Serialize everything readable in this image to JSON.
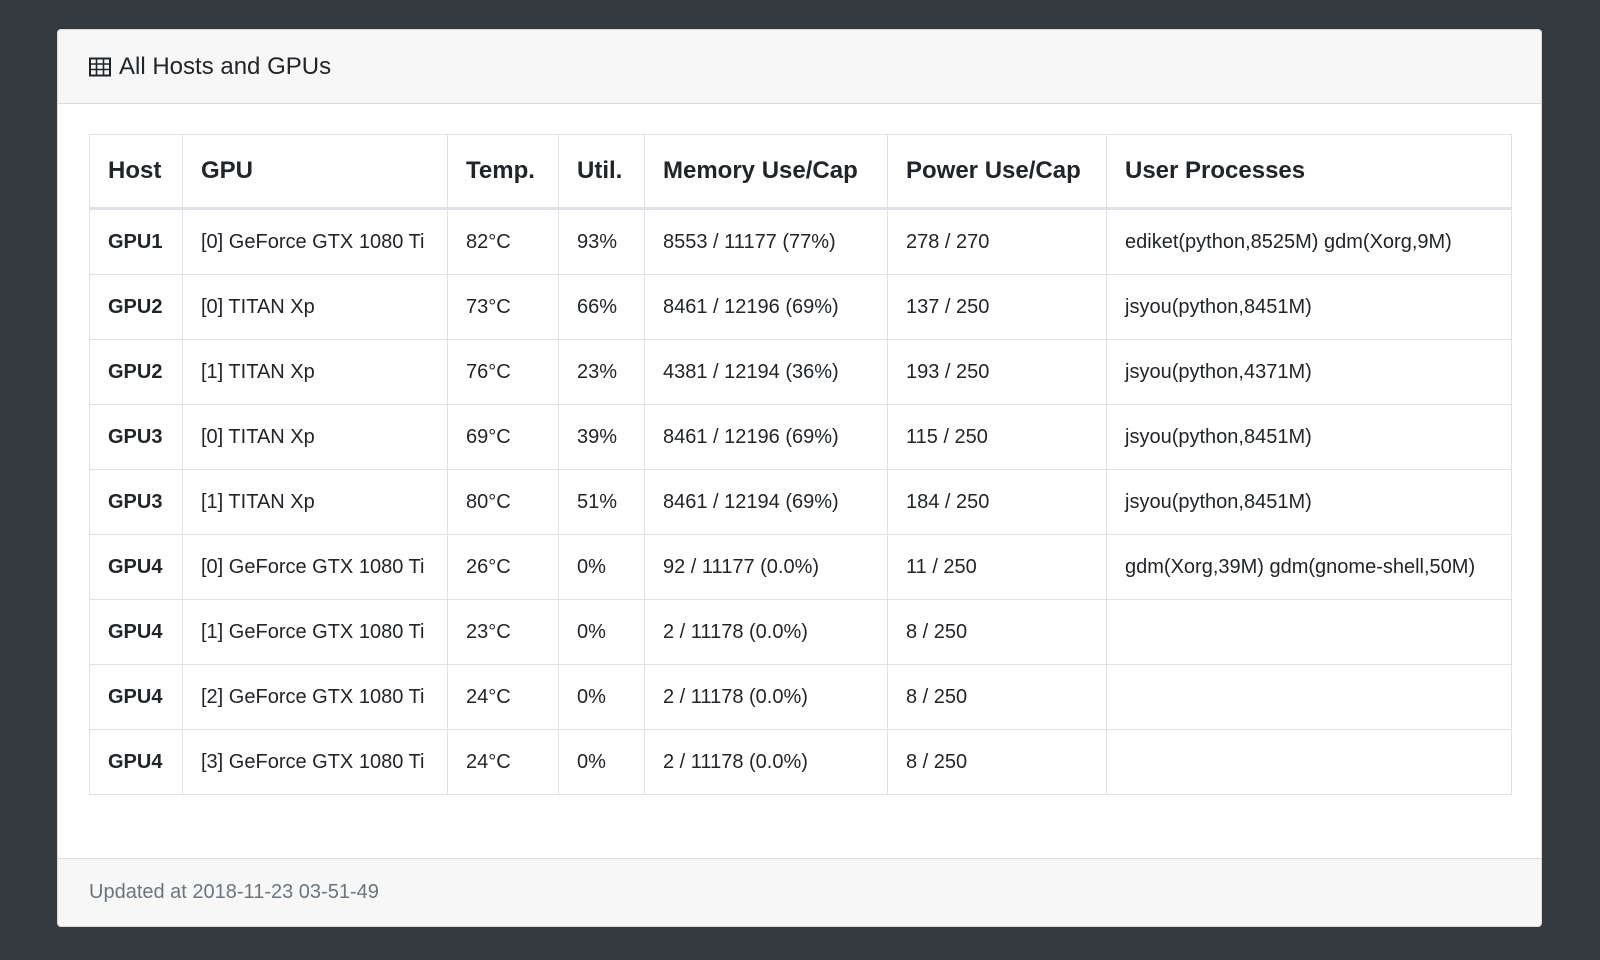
{
  "card": {
    "title": "All Hosts and GPUs",
    "title_icon": "table-icon"
  },
  "table": {
    "headers": [
      "Host",
      "GPU",
      "Temp.",
      "Util.",
      "Memory Use/Cap",
      "Power Use/Cap",
      "User Processes"
    ],
    "rows": [
      {
        "host": "GPU1",
        "gpu": "[0] GeForce GTX 1080 Ti",
        "temp": "82°C",
        "util": "93%",
        "memory": "8553 / 11177 (77%)",
        "power": "278 / 270",
        "processes": "ediket(python,8525M) gdm(Xorg,9M)"
      },
      {
        "host": "GPU2",
        "gpu": "[0] TITAN Xp",
        "temp": "73°C",
        "util": "66%",
        "memory": "8461 / 12196 (69%)",
        "power": "137 / 250",
        "processes": "jsyou(python,8451M)"
      },
      {
        "host": "GPU2",
        "gpu": "[1] TITAN Xp",
        "temp": "76°C",
        "util": "23%",
        "memory": "4381 / 12194 (36%)",
        "power": "193 / 250",
        "processes": "jsyou(python,4371M)"
      },
      {
        "host": "GPU3",
        "gpu": "[0] TITAN Xp",
        "temp": "69°C",
        "util": "39%",
        "memory": "8461 / 12196 (69%)",
        "power": "115 / 250",
        "processes": "jsyou(python,8451M)"
      },
      {
        "host": "GPU3",
        "gpu": "[1] TITAN Xp",
        "temp": "80°C",
        "util": "51%",
        "memory": "8461 / 12194 (69%)",
        "power": "184 / 250",
        "processes": "jsyou(python,8451M)"
      },
      {
        "host": "GPU4",
        "gpu": "[0] GeForce GTX 1080 Ti",
        "temp": "26°C",
        "util": "0%",
        "memory": "92 / 11177 (0.0%)",
        "power": "11 / 250",
        "processes": "gdm(Xorg,39M) gdm(gnome-shell,50M)"
      },
      {
        "host": "GPU4",
        "gpu": "[1] GeForce GTX 1080 Ti",
        "temp": "23°C",
        "util": "0%",
        "memory": "2 / 11178 (0.0%)",
        "power": "8 / 250",
        "processes": ""
      },
      {
        "host": "GPU4",
        "gpu": "[2] GeForce GTX 1080 Ti",
        "temp": "24°C",
        "util": "0%",
        "memory": "2 / 11178 (0.0%)",
        "power": "8 / 250",
        "processes": ""
      },
      {
        "host": "GPU4",
        "gpu": "[3] GeForce GTX 1080 Ti",
        "temp": "24°C",
        "util": "0%",
        "memory": "2 / 11178 (0.0%)",
        "power": "8 / 250",
        "processes": ""
      }
    ]
  },
  "footer": {
    "updated_text": "Updated at 2018-11-23 03-51-49"
  },
  "colors": {
    "page_background": "#343a40",
    "card_background": "#ffffff",
    "header_background": "#f7f7f7",
    "border": "#dee2e6",
    "muted_text": "#6c757d"
  }
}
